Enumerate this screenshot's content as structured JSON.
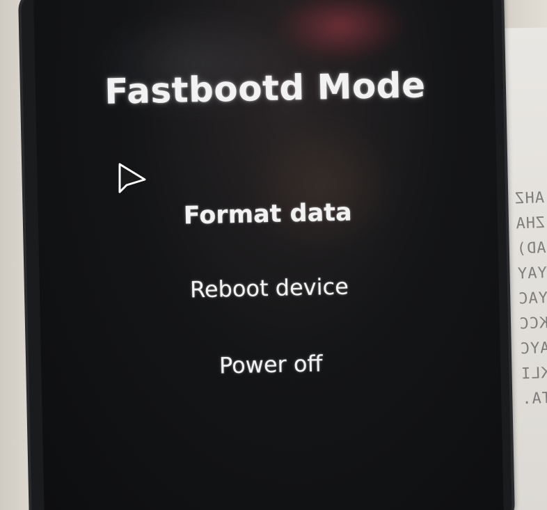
{
  "screen": {
    "title": "Fastbootd Mode",
    "menu": [
      {
        "label": "Format data",
        "selected": true
      },
      {
        "label": "Reboot device",
        "selected": false
      },
      {
        "label": "Power off",
        "selected": false
      }
    ]
  },
  "colors": {
    "screen_background": "#141517",
    "text": "#f2f2f2",
    "cursor_fill": "#1a1a1a",
    "cursor_outline": "#ffffff"
  },
  "icons": {
    "pointer": "mouse-pointer-icon"
  },
  "background_paper_text": "AHZ\nZHA\nAD)\nYAY\nYAC\nKCC\nAYC\nKLI\nTA."
}
